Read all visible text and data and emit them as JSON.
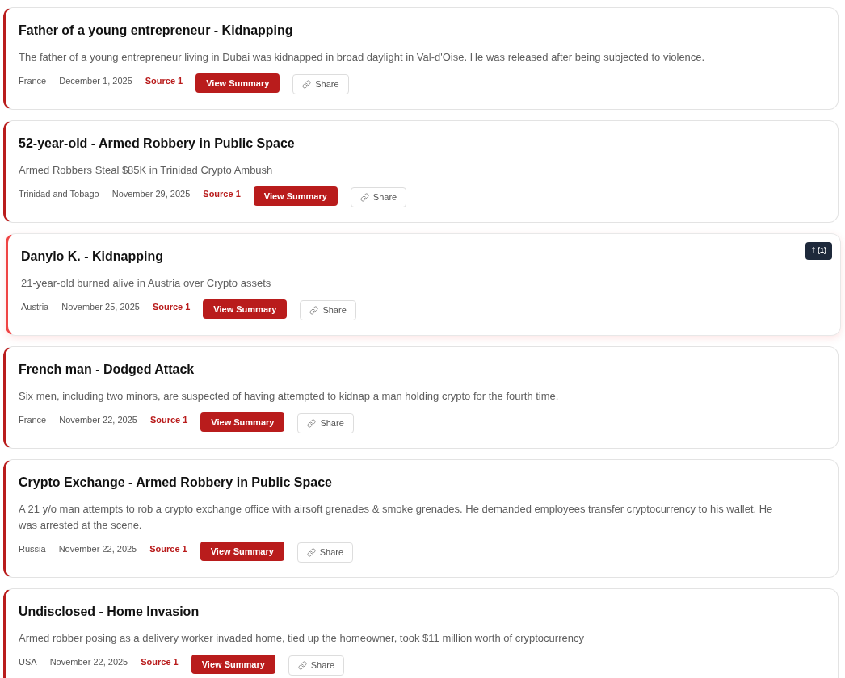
{
  "incidents": [
    {
      "title": "Father of a young entrepreneur - Kidnapping",
      "description": "The father of a young entrepreneur living in Dubai was kidnapped in broad daylight in Val-d'Oise. He was released after being subjected to violence.",
      "country": "France",
      "date": "December 1, 2025",
      "source": "Source 1",
      "summary_button": "View Summary",
      "share_button": "Share",
      "highlighted": false
    },
    {
      "title": "52-year-old - Armed Robbery in Public Space",
      "description": "Armed Robbers Steal $85K in Trinidad Crypto Ambush",
      "country": "Trinidad and Tobago",
      "date": "November 29, 2025",
      "source": "Source 1",
      "summary_button": "View Summary",
      "share_button": "Share",
      "highlighted": false
    },
    {
      "title": "Danylo K. - Kidnapping",
      "description": "21-year-old burned alive in Austria over Crypto assets",
      "country": "Austria",
      "date": "November 25, 2025",
      "source": "Source 1",
      "summary_button": "View Summary",
      "share_button": "Share",
      "highlighted": true,
      "badge": "† (1)"
    },
    {
      "title": "French man - Dodged Attack",
      "description": "Six men, including two minors, are suspected of having attempted to kidnap a man holding crypto for the fourth time.",
      "country": "France",
      "date": "November 22, 2025",
      "source": "Source 1",
      "summary_button": "View Summary",
      "share_button": "Share",
      "highlighted": false
    },
    {
      "title": "Crypto Exchange - Armed Robbery in Public Space",
      "description": "A 21 y/o man attempts to rob a crypto exchange office with airsoft grenades & smoke grenades. He demanded employees transfer cryptocurrency to his wallet. He was arrested at the scene.",
      "country": "Russia",
      "date": "November 22, 2025",
      "source": "Source 1",
      "summary_button": "View Summary",
      "share_button": "Share",
      "highlighted": false
    },
    {
      "title": "Undisclosed - Home Invasion",
      "description": "Armed robber posing as a delivery worker invaded home, tied up the homeowner, took $11 million worth of cryptocurrency",
      "country": "USA",
      "date": "November 22, 2025",
      "source": "Source 1",
      "summary_button": "View Summary",
      "share_button": "Share",
      "highlighted": false
    }
  ]
}
